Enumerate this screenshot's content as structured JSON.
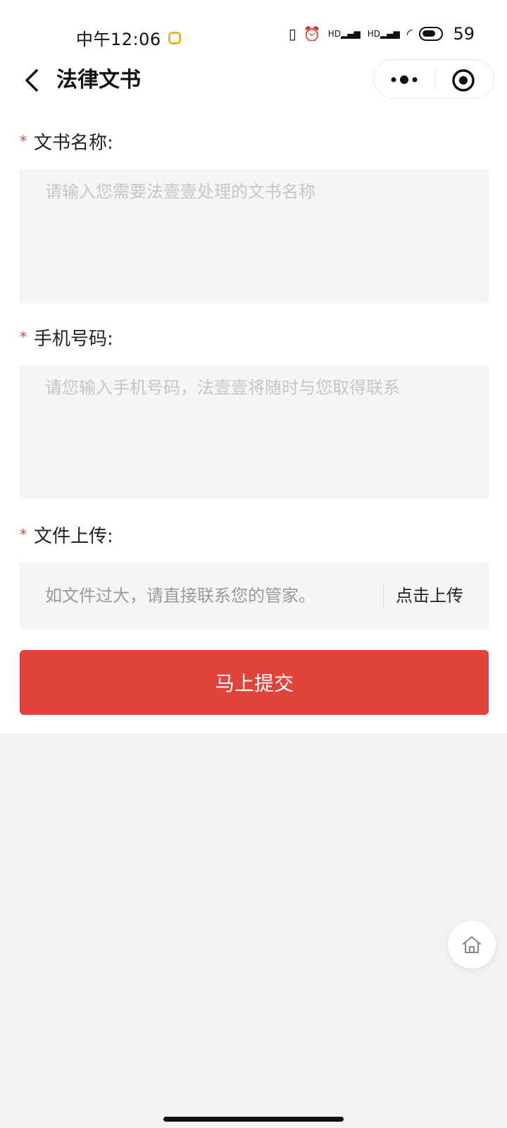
{
  "status_bar": {
    "time": "中午12:06",
    "signal_1": "HD",
    "signal_2": "HD",
    "battery_level": "59"
  },
  "nav": {
    "title": "法律文书"
  },
  "form": {
    "doc_name": {
      "label": "文书名称:",
      "placeholder": "请输入您需要法壹壹处理的文书名称"
    },
    "phone": {
      "label": "手机号码:",
      "placeholder": "请您输入手机号码，法壹壹将随时与您取得联系"
    },
    "upload": {
      "label": "文件上传:",
      "hint": "如文件过大，请直接联系您的管家。",
      "button_label": "点击上传"
    },
    "required_mark": "*",
    "submit_label": "马上提交"
  },
  "colors": {
    "accent": "#e0433a",
    "input_bg": "#f5f5f5",
    "page_bg": "#f2f2f2"
  }
}
